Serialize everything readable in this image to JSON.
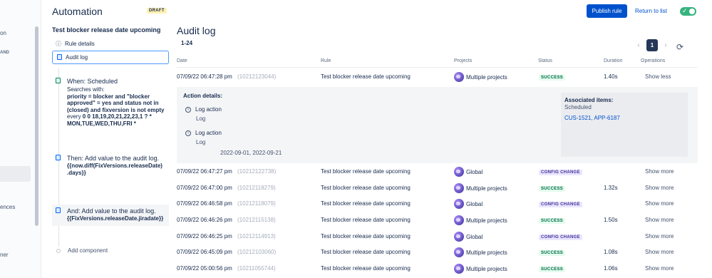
{
  "nav": {
    "items": [
      {
        "label": "on",
        "small": false
      },
      {
        "label": "AND",
        "small": true
      },
      {
        "label": "ences",
        "small": false
      },
      {
        "label": "ner",
        "small": false
      }
    ]
  },
  "header": {
    "title": "Automation",
    "draft": "DRAFT",
    "publish": "Publish rule",
    "return": "Return to list"
  },
  "rule": {
    "name": "Test blocker release date upcoming",
    "rule_details": "Rule details",
    "audit_log": "Audit log",
    "when_title": "When: Scheduled",
    "when_searches": "Searches with:",
    "when_jql": "priority = blocker and \"blocker approved\" = yes and status not in (closed) and fixversion is not empty",
    "when_every": "every",
    "when_cron": "0 0 18,19,20,21,22,23,1 ? * MON,TUE,WED,THU,FRI *",
    "then_title": "Then: Add value to the audit log.",
    "then_value": "{{now.diff(FixVersions.releaseDate) .days}}",
    "and_title": "And: Add value to the audit log.",
    "and_value": "{{FixVersions.releaseDate.jiradate}}",
    "add_component": "Add component"
  },
  "audit": {
    "title": "Audit log",
    "range": "1-24",
    "page": "1",
    "columns": {
      "date": "Date",
      "rule": "Rule",
      "projects": "Projects",
      "status": "Status",
      "duration": "Duration",
      "operations": "Operations"
    },
    "rows": [
      {
        "date": "07/09/22 06:47:28 pm",
        "id": "(10212123044)",
        "rule": "Test blocker release date upcoming",
        "project": "Multiple projects",
        "status": "SUCCESS",
        "duration": "1.40s",
        "op": "Show less"
      },
      {
        "date": "07/09/22 06:47:27 pm",
        "id": "(10212122738)",
        "rule": "Test blocker release date upcoming",
        "project": "Global",
        "status": "CONFIG CHANGE",
        "duration": "",
        "op": "Show more"
      },
      {
        "date": "07/09/22 06:47:00 pm",
        "id": "(10212118279)",
        "rule": "Test blocker release date upcoming",
        "project": "Multiple projects",
        "status": "SUCCESS",
        "duration": "1.32s",
        "op": "Show more"
      },
      {
        "date": "07/09/22 06:46:58 pm",
        "id": "(10212118079)",
        "rule": "Test blocker release date upcoming",
        "project": "Global",
        "status": "CONFIG CHANGE",
        "duration": "",
        "op": "Show more"
      },
      {
        "date": "07/09/22 06:46:26 pm",
        "id": "(10212115138)",
        "rule": "Test blocker release date upcoming",
        "project": "Multiple projects",
        "status": "SUCCESS",
        "duration": "1.50s",
        "op": "Show more"
      },
      {
        "date": "07/09/22 06:46:25 pm",
        "id": "(10212114913)",
        "rule": "Test blocker release date upcoming",
        "project": "Global",
        "status": "CONFIG CHANGE",
        "duration": "",
        "op": "Show more"
      },
      {
        "date": "07/09/22 06:45:09 pm",
        "id": "(10212103060)",
        "rule": "Test blocker release date upcoming",
        "project": "Multiple projects",
        "status": "SUCCESS",
        "duration": "1.08s",
        "op": "Show more"
      },
      {
        "date": "07/09/22 05:00:56 pm",
        "id": "(10211055744)",
        "rule": "Test blocker release date upcoming",
        "project": "Multiple projects",
        "status": "SUCCESS",
        "duration": "1.06s",
        "op": "Show more"
      }
    ],
    "expanded": {
      "label": "Action details:",
      "actions": [
        {
          "name": "Log action",
          "sub": "Log",
          "value": ""
        },
        {
          "name": "Log action",
          "sub": "Log",
          "value": "2022-09-01, 2022-09-21"
        }
      ],
      "assoc_title": "Associated items:",
      "assoc_sub": "Scheduled",
      "assoc_links": "CUS-1521, APP-6187"
    }
  },
  "colors": {
    "primary": "#0052cc",
    "success_bg": "#e3fcef",
    "config_bg": "#eae6ff",
    "toggle": "#36b37e"
  }
}
